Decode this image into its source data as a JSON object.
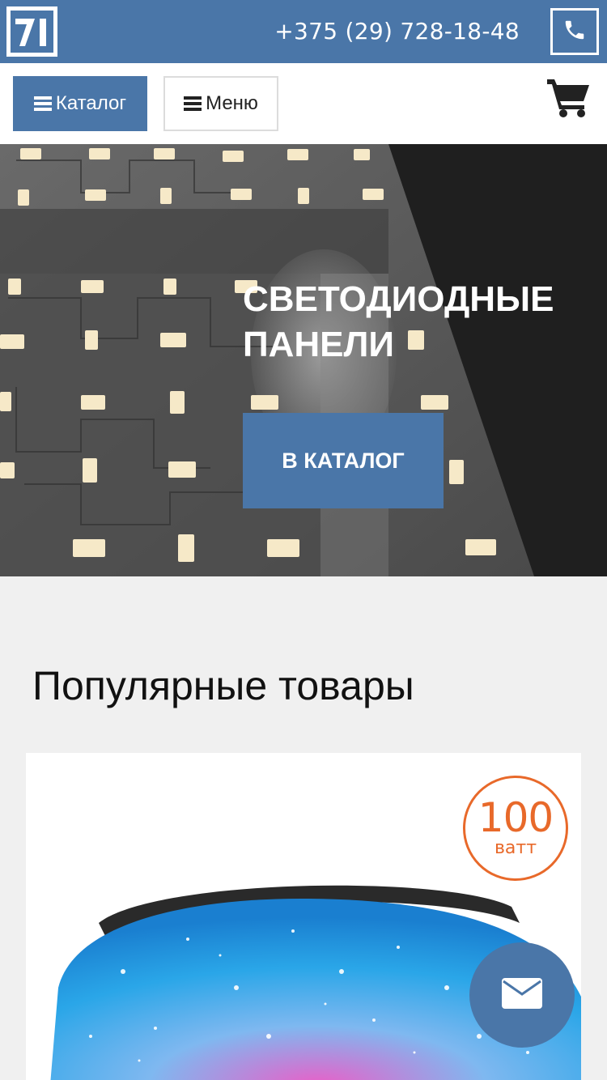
{
  "header": {
    "phone_number": "+375 (29) 728-18-48",
    "brand_color": "#4a76a8"
  },
  "nav": {
    "catalog_label": "Каталог",
    "menu_label": "Меню"
  },
  "hero": {
    "title_line1": "СВЕТОДИОДНЫЕ",
    "title_line2": "ПАНЕЛИ",
    "cta_label": "В КАТАЛОГ"
  },
  "popular": {
    "title": "Популярные товары",
    "products": [
      {
        "badge_value": "100",
        "badge_unit": "ватт"
      }
    ]
  },
  "icons": [
    "logo-icon",
    "phone-icon",
    "hamburger-icon",
    "cart-icon",
    "mail-icon"
  ]
}
